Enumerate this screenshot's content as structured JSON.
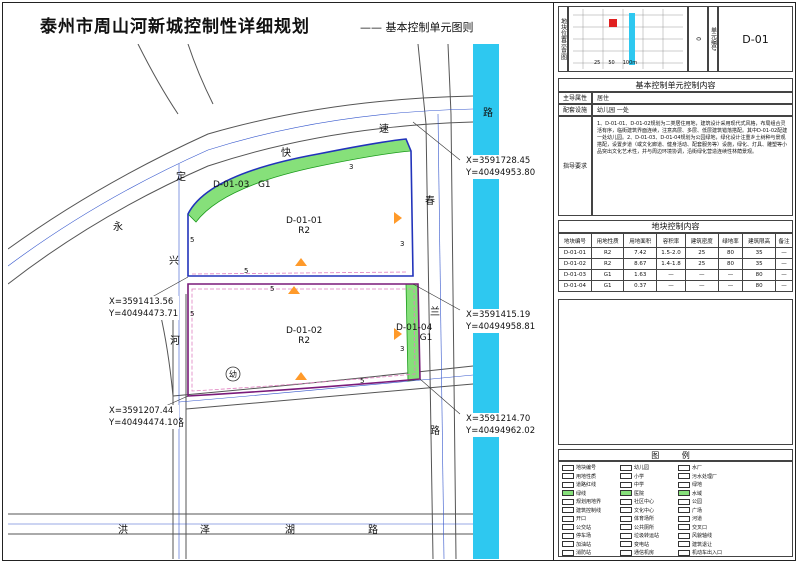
{
  "title": "泰州市周山河新城控制性详细规划",
  "subtitle": "—— 基本控制单元图则",
  "map": {
    "roads": {
      "top": [
        "路",
        "速",
        "快",
        "定",
        "永"
      ],
      "left_vertical": [
        "兴",
        "河",
        "路"
      ],
      "right_vertical": [
        "春",
        "兰",
        "路"
      ],
      "bottom": [
        "洪",
        "泽",
        "湖",
        "路"
      ]
    },
    "parcels": [
      {
        "code": "D-01-03",
        "landuse": "G1"
      },
      {
        "code": "D-01-01",
        "landuse": "R2"
      },
      {
        "code": "D-01-02",
        "landuse": "R2"
      },
      {
        "code": "D-01-04",
        "landuse": "G1"
      }
    ],
    "setbacks": [
      "3",
      "5",
      "3",
      "5",
      "5",
      "5",
      "3",
      "5"
    ],
    "kindergarten_symbol": "幼",
    "coords": [
      {
        "x": "X=3591728.45",
        "y": "Y=40494953.80"
      },
      {
        "x": "X=3591413.56",
        "y": "Y=40494473.71"
      },
      {
        "x": "X=3591415.19",
        "y": "Y=40494958.81"
      },
      {
        "x": "X=3591207.44",
        "y": "Y=40494474.10"
      },
      {
        "x": "X=3591214.70",
        "y": "Y=40494962.02"
      }
    ]
  },
  "panel": {
    "location_label": "地块位置示意图",
    "unit_code_label": "单元编号",
    "unit_code": "D-01",
    "scale_labels": [
      "0",
      "25",
      "50",
      "100m"
    ],
    "control_heading": "基本控制单元控制内容",
    "main_attr_label": "主导属性",
    "main_attr_value": "居住",
    "facilities_label": "配套设施",
    "facilities_value": "幼儿园 一处",
    "guidance_label": "指导要求",
    "guidance_text": "1、D-01-01、D-01-02规划为二类居住用地，建筑设计采用现代式风格，布局组合灵活有序，临街建筑界面连续，注意高层、多层、低层建筑错落搭配。其中D-01-02配建一处幼儿园。2、D-01-03、D-01-04规划为公园绿地，绿化设计注重乡土树种与景观搭配，设置步道（或文化廊道、健身活动、配套服务等）设施，绿化、灯具、雕塑等小品突出文化艺术性，并与周边环境协调，沿街绿化营造连续性林荫景观。",
    "parcel_table_heading": "地块控制内容",
    "table_headers": [
      "地块编号",
      "用地性质",
      "用地面积",
      "容积率",
      "建筑密度",
      "绿地率",
      "建筑限高",
      "备注"
    ],
    "table_rows": [
      [
        "D-01-01",
        "R2",
        "7.42",
        "1.5-2.0",
        "25",
        "80",
        "35",
        "—"
      ],
      [
        "D-01-02",
        "R2",
        "8.67",
        "1.4-1.8",
        "25",
        "80",
        "35",
        "—"
      ],
      [
        "D-01-03",
        "G1",
        "1.63",
        "—",
        "—",
        "—",
        "80",
        "—"
      ],
      [
        "D-01-04",
        "G1",
        "0.37",
        "—",
        "—",
        "—",
        "80",
        "—"
      ]
    ],
    "legend_heading": "图 例",
    "legend": [
      "地块编号",
      "用地性质",
      "道路红线",
      "绿线",
      "规划用地界",
      "建筑控制线",
      "开口",
      "公交站",
      "停车场",
      "加油站",
      "消防站",
      "幼儿园",
      "小学",
      "中学",
      "医院",
      "社区中心",
      "文化中心",
      "体育场所",
      "公共厕所",
      "垃圾转运站",
      "变电站",
      "通信机房",
      "水厂",
      "污水处理厂",
      "绿地",
      "水域",
      "公园",
      "广场",
      "河道",
      "交叉口",
      "风貌轴线",
      "建筑退让",
      "机动车出入口"
    ]
  }
}
